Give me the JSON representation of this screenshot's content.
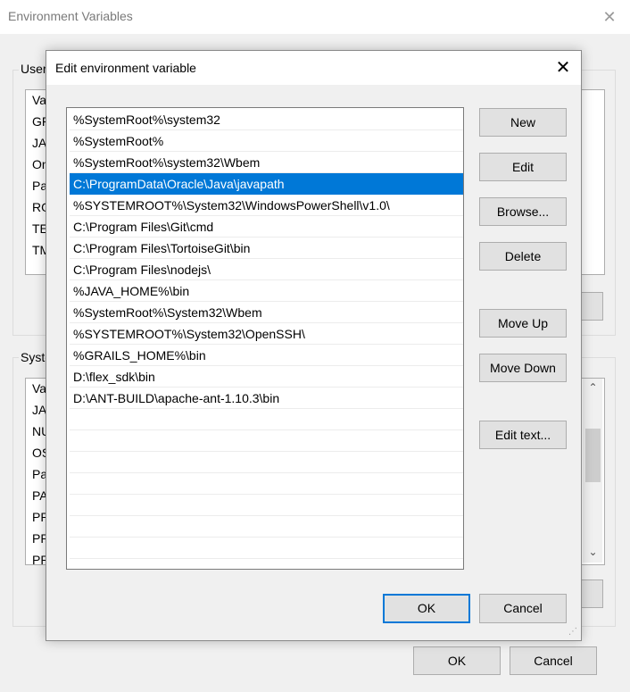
{
  "background_window": {
    "title": "Environment Variables",
    "user_group_label": "User",
    "user_list_items": [
      "Va",
      "GR",
      "JAV",
      "On",
      "Pa",
      "RO",
      "TE",
      "TM"
    ],
    "system_group_label": "Syste",
    "system_list_items": [
      "Va",
      "JAV",
      "NU",
      "OS",
      "Pa",
      "PA",
      "PR",
      "PR",
      "PR"
    ],
    "ok_label": "OK",
    "cancel_label": "Cancel"
  },
  "dialog": {
    "title": "Edit environment variable",
    "entries": [
      "%SystemRoot%\\system32",
      "%SystemRoot%",
      "%SystemRoot%\\system32\\Wbem",
      "C:\\ProgramData\\Oracle\\Java\\javapath",
      "%SYSTEMROOT%\\System32\\WindowsPowerShell\\v1.0\\",
      "C:\\Program Files\\Git\\cmd",
      "C:\\Program Files\\TortoiseGit\\bin",
      "C:\\Program Files\\nodejs\\",
      "%JAVA_HOME%\\bin",
      "%SystemRoot%\\System32\\Wbem",
      "%SYSTEMROOT%\\System32\\OpenSSH\\",
      "%GRAILS_HOME%\\bin",
      "D:\\flex_sdk\\bin",
      "D:\\ANT-BUILD\\apache-ant-1.10.3\\bin"
    ],
    "selected_index": 3,
    "buttons": {
      "new": "New",
      "edit": "Edit",
      "browse": "Browse...",
      "delete": "Delete",
      "move_up": "Move Up",
      "move_down": "Move Down",
      "edit_text": "Edit text..."
    },
    "ok_label": "OK",
    "cancel_label": "Cancel"
  },
  "colors": {
    "selection": "#0078d7",
    "button_face": "#e1e1e1",
    "window_bg": "#f0f0f0"
  }
}
